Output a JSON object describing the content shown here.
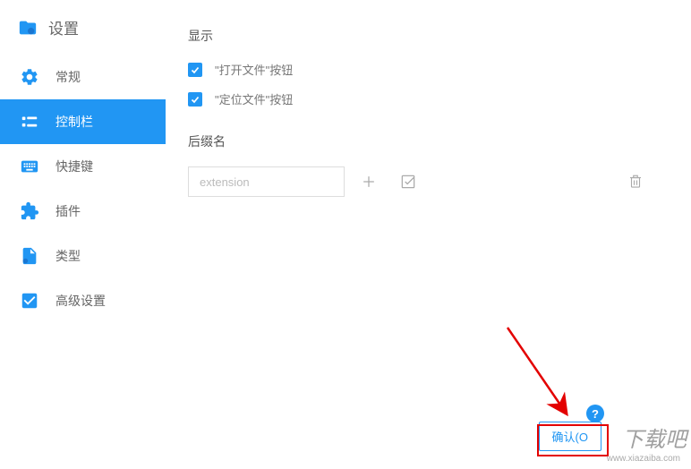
{
  "header": {
    "title": "设置"
  },
  "sidebar": {
    "items": [
      {
        "label": "常规"
      },
      {
        "label": "控制栏"
      },
      {
        "label": "快捷键"
      },
      {
        "label": "插件"
      },
      {
        "label": "类型"
      },
      {
        "label": "高级设置"
      }
    ]
  },
  "main": {
    "display_title": "显示",
    "checkbox1_label": "\"打开文件\"按钮",
    "checkbox2_label": "\"定位文件\"按钮",
    "suffix_title": "后缀名",
    "ext_placeholder": "extension"
  },
  "footer": {
    "confirm_label": "确认(O"
  },
  "watermark": {
    "text": "下载吧",
    "sub": "www.xiazaiba.com"
  }
}
